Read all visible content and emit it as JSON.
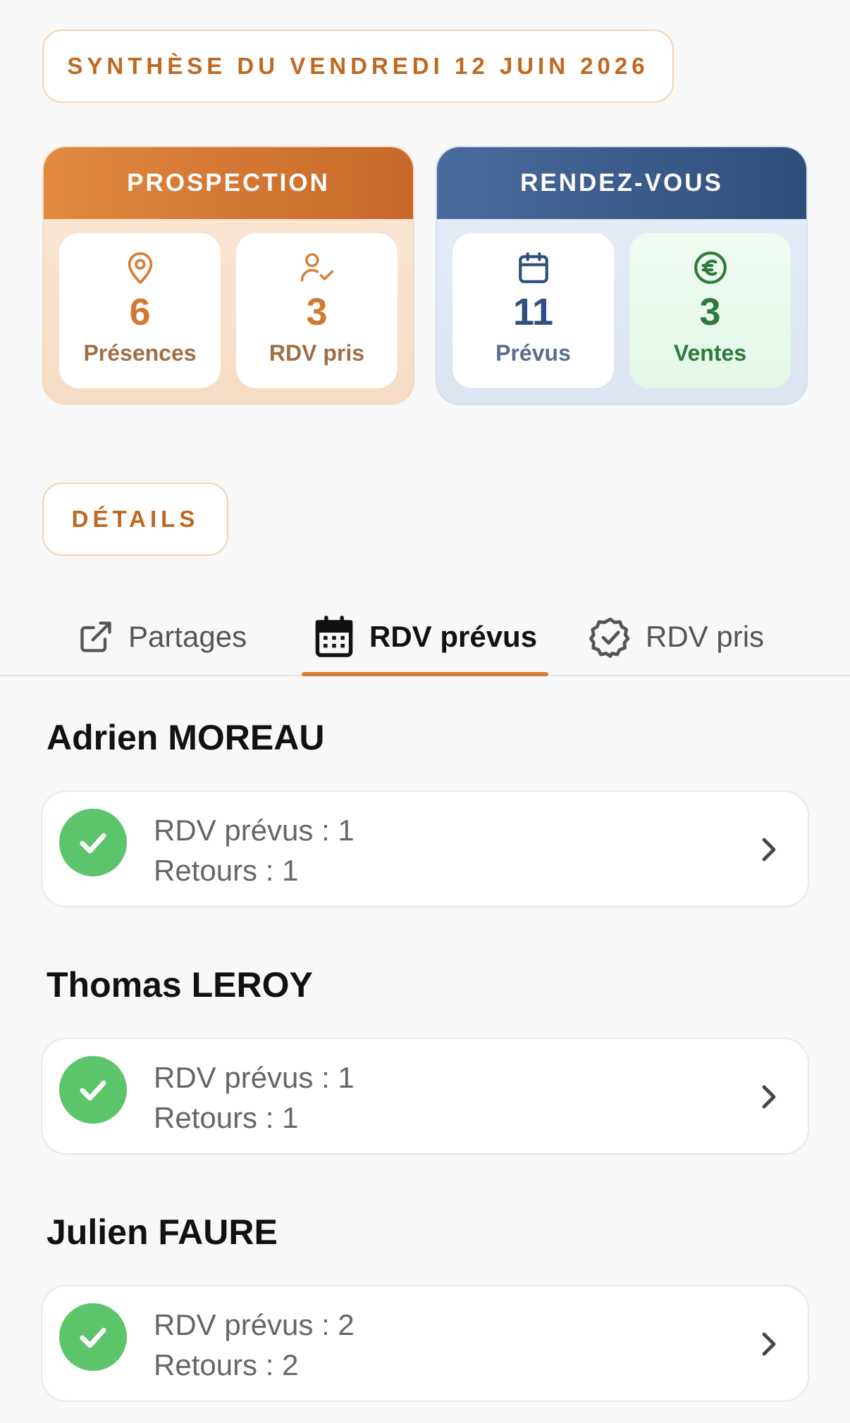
{
  "summary_title": "SYNTHÈSE DU VENDREDI 12 JUIN 2026",
  "prospection": {
    "title": "PROSPECTION",
    "presences": {
      "value": "6",
      "label": "Présences",
      "icon": "map-pin-icon"
    },
    "rdv_pris": {
      "value": "3",
      "label": "RDV pris",
      "icon": "user-check-icon"
    }
  },
  "rendezvous": {
    "title": "RENDEZ-VOUS",
    "prevus": {
      "value": "11",
      "label": "Prévus",
      "icon": "calendar-icon"
    },
    "ventes": {
      "value": "3",
      "label": "Ventes",
      "icon": "euro-icon"
    }
  },
  "details_title": "DÉTAILS",
  "tabs": [
    {
      "label": "Partages",
      "icon": "external-link-icon",
      "active": false
    },
    {
      "label": "RDV prévus",
      "icon": "calendar-grid-icon",
      "active": true
    },
    {
      "label": "RDV pris",
      "icon": "badge-check-icon",
      "active": false
    }
  ],
  "agents": [
    {
      "name": "Adrien MOREAU",
      "line1": "RDV prévus : 1",
      "line2": "Retours : 1"
    },
    {
      "name": "Thomas LEROY",
      "line1": "RDV prévus : 1",
      "line2": "Retours : 1"
    },
    {
      "name": "Julien FAURE",
      "line1": "RDV prévus : 2",
      "line2": "Retours : 2"
    }
  ],
  "colors": {
    "accent_orange": "#d6803a",
    "navy": "#2f4f7e",
    "success_green": "#5cc46a"
  }
}
